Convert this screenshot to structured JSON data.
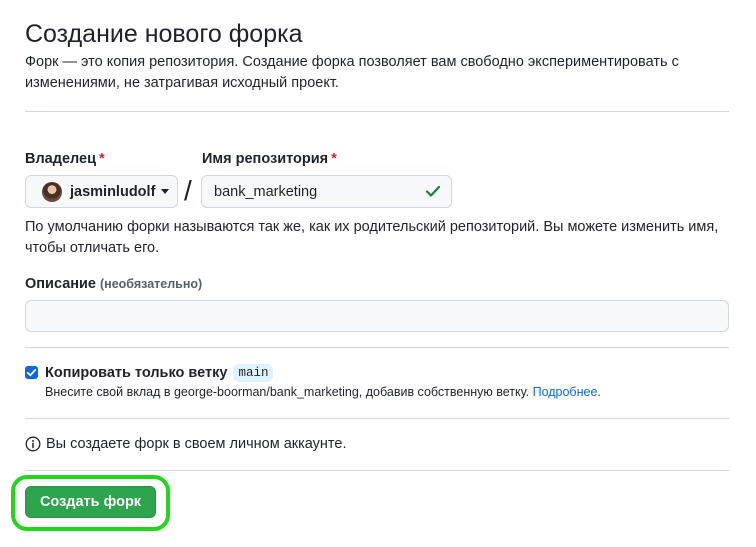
{
  "header": {
    "title": "Создание нового форка",
    "subtitle": "Форк — это копия репозитория. Создание форка позволяет вам свободно экспериментировать с изменениями, не затрагивая исходный проект."
  },
  "owner": {
    "label": "Владелец",
    "required_mark": "*",
    "value": "jasminludolf"
  },
  "separator": "/",
  "repository": {
    "label": "Имя репозитория",
    "required_mark": "*",
    "value": "bank_marketing"
  },
  "naming_hint": "По умолчанию форки называются так же, как их родительский репозиторий. Вы можете изменить имя, чтобы отличать его.",
  "description": {
    "label": "Описание",
    "optional": "(необязательно)",
    "value": ""
  },
  "copy_branch": {
    "checked": true,
    "label": "Копировать только ветку",
    "branch": "main",
    "note": "Внесите свой вклад в george-boorman/bank_marketing, добавив собственную ветку.",
    "link_text": "Подробнее",
    "note_suffix": "."
  },
  "info": {
    "text": "Вы создаете форк в своем личном аккаунте."
  },
  "actions": {
    "create_label": "Создать форк"
  },
  "colors": {
    "primary_button": "#2da44e",
    "highlight": "#22d61e",
    "link": "#0969da",
    "required": "#cf222e",
    "valid": "#1a7f37"
  }
}
